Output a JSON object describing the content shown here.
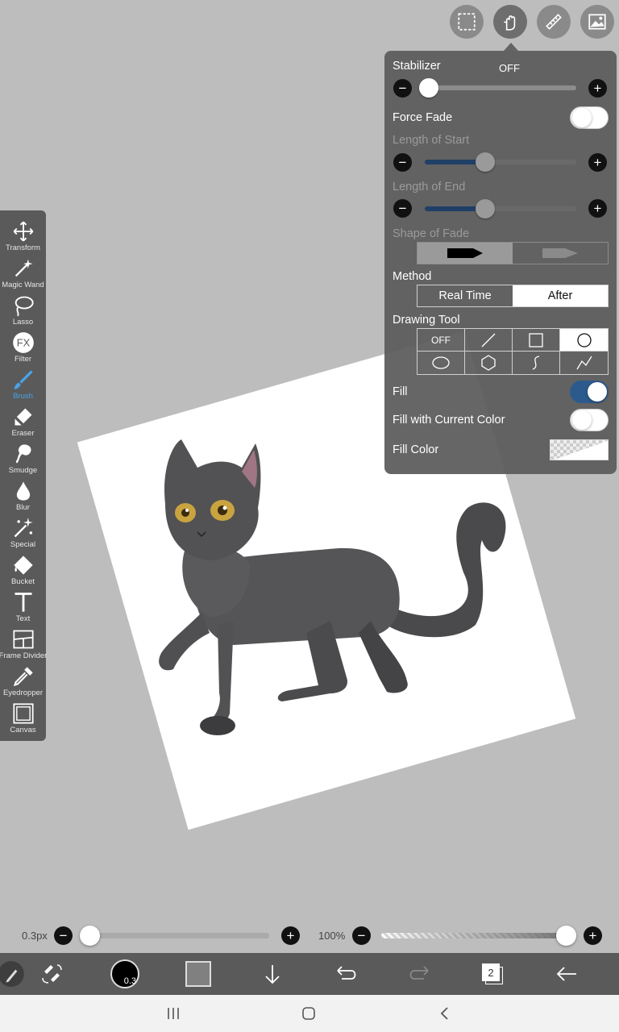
{
  "top_toolbar": {
    "items": [
      {
        "icon": "selection-icon"
      },
      {
        "icon": "hand-pointer-icon",
        "active": true
      },
      {
        "icon": "ruler-icon"
      },
      {
        "icon": "image-icon"
      }
    ]
  },
  "panel": {
    "stabilizer": {
      "label": "Stabilizer",
      "value": "OFF",
      "level": 0
    },
    "force_fade": {
      "label": "Force Fade",
      "on": false
    },
    "length_of_start": {
      "label": "Length of Start",
      "level": 0.4
    },
    "length_of_end": {
      "label": "Length of End",
      "level": 0.4
    },
    "shape_of_fade": {
      "label": "Shape of Fade"
    },
    "method": {
      "label": "Method",
      "options": [
        "Real Time",
        "After"
      ],
      "selected": "After"
    },
    "drawing_tool": {
      "label": "Drawing Tool",
      "off_label": "OFF",
      "selected": "circle"
    },
    "fill": {
      "label": "Fill",
      "on": true
    },
    "fill_with_current_color": {
      "label": "Fill with Current Color",
      "on": false
    },
    "fill_color": {
      "label": "Fill Color"
    }
  },
  "left_tools": [
    {
      "label": "Transform",
      "icon": "move-arrows-icon"
    },
    {
      "label": "Magic Wand",
      "icon": "magic-wand-icon"
    },
    {
      "label": "Lasso",
      "icon": "lasso-icon"
    },
    {
      "label": "Filter",
      "icon": "fx-filter-icon"
    },
    {
      "label": "Brush",
      "icon": "brush-icon",
      "active": true
    },
    {
      "label": "Eraser",
      "icon": "eraser-icon"
    },
    {
      "label": "Smudge",
      "icon": "smudge-icon"
    },
    {
      "label": "Blur",
      "icon": "blur-drop-icon"
    },
    {
      "label": "Special",
      "icon": "special-wand-icon"
    },
    {
      "label": "Bucket",
      "icon": "bucket-icon"
    },
    {
      "label": "Text",
      "icon": "text-icon"
    },
    {
      "label": "Frame Divider",
      "icon": "frame-divider-icon"
    },
    {
      "label": "Eyedropper",
      "icon": "eyedropper-icon"
    },
    {
      "label": "Canvas",
      "icon": "canvas-icon"
    }
  ],
  "bottom_sliders": {
    "brush_size": {
      "label": "0.3px",
      "level": 0
    },
    "opacity": {
      "label": "100%",
      "level": 1
    }
  },
  "bottom_bar": {
    "brush_size_badge": "0.3",
    "layers_count": "2",
    "primary_color": "#000000",
    "secondary_color": "#808080"
  },
  "colors": {
    "panel_bg": "#5a5a5a",
    "accent": "#2c5a8d",
    "active_tool": "#4aa3e8"
  }
}
